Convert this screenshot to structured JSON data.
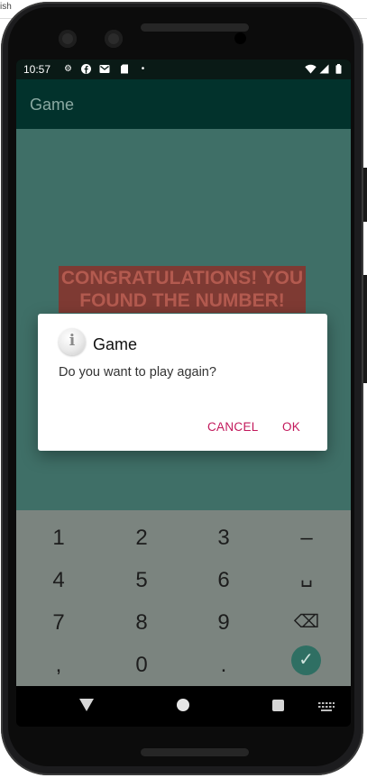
{
  "status_bar": {
    "time": "10:57",
    "icons": [
      "settings-icon",
      "facebook-icon",
      "gmail-icon",
      "sd-card-icon",
      "dot-icon",
      "wifi-icon",
      "signal-icon",
      "battery-icon"
    ]
  },
  "app_bar": {
    "title": "Game"
  },
  "content": {
    "banner_text": "CONGRATULATIONS! YOU FOUND THE NUMBER!"
  },
  "dialog": {
    "title": "Game",
    "message": "Do you want to play again?",
    "cancel_label": "CANCEL",
    "ok_label": "OK"
  },
  "keyboard": {
    "rows": [
      [
        "1",
        "2",
        "3",
        "–"
      ],
      [
        "4",
        "5",
        "6",
        "␣"
      ],
      [
        "7",
        "8",
        "9",
        "⌫"
      ],
      [
        ",",
        "0",
        ".",
        "✓"
      ]
    ]
  },
  "nav_bar": {
    "icons": [
      "back-icon",
      "home-icon",
      "recents-icon",
      "keyboard-icon"
    ]
  },
  "colors": {
    "app_bar": "#02322c",
    "content_scrim": "#3f6f67",
    "banner": "#7e3a33",
    "accent": "#c2185b",
    "enter_key": "#2f6f63"
  }
}
